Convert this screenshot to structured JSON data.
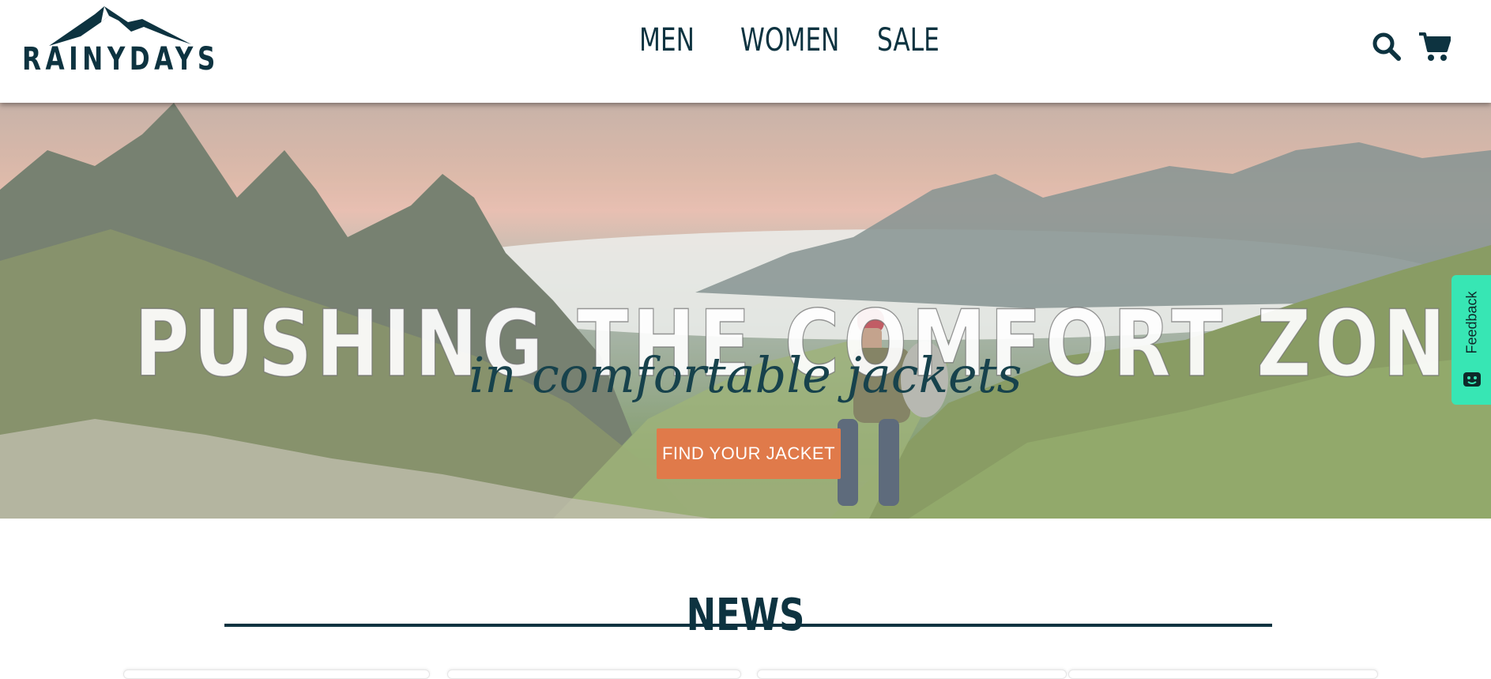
{
  "header": {
    "logo_text": "RAINYDAYS",
    "nav": [
      "MEN",
      "WOMEN",
      "SALE"
    ],
    "icons": {
      "search": "search-icon",
      "cart": "cart-icon"
    }
  },
  "hero": {
    "title": "PUSHING THE COMFORT ZONE",
    "subtitle": "in comfortable jackets",
    "cta_label": "FIND YOUR JACKET"
  },
  "feedback": {
    "label": "Feedback",
    "icon": "feedback-face-icon"
  },
  "news": {
    "title": "NEWS"
  },
  "colors": {
    "brand_dark": "#0d3340",
    "cta": "#e07a4a",
    "feedback": "#37e6b4",
    "text_light": "#ffffff"
  }
}
